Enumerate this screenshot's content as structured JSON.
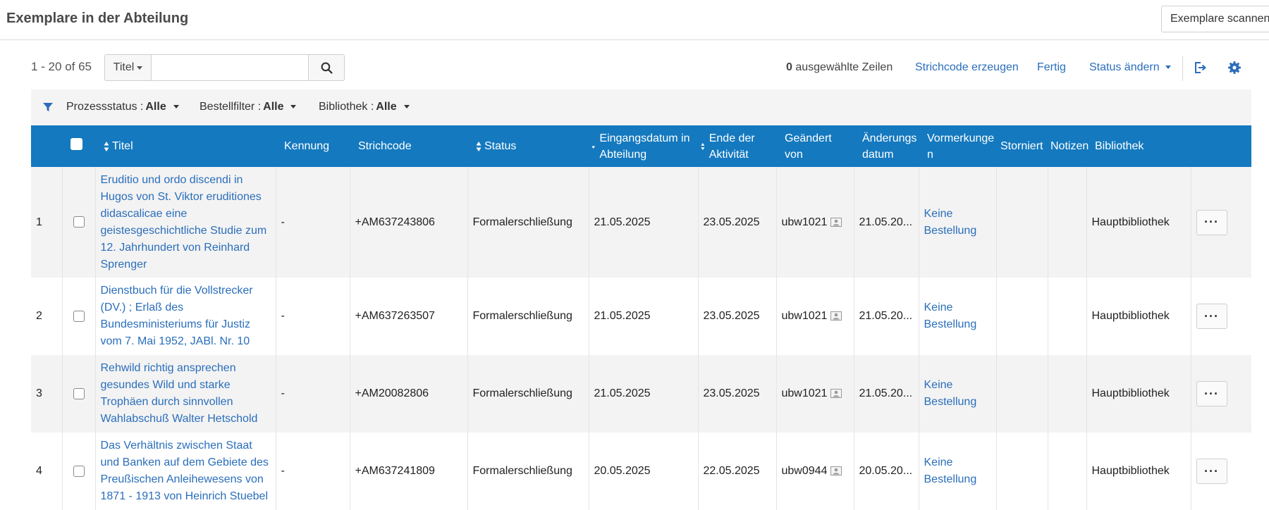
{
  "header": {
    "title": "Exemplare in der Abteilung",
    "scan_button": "Exemplare scannen"
  },
  "toolbar": {
    "count": "1 - 20 of 65",
    "search_field": "Titel",
    "search_value": "",
    "selected_count": "0",
    "selected_label": "ausgewählte Zeilen",
    "barcode_link": "Strichcode erzeugen",
    "done_link": "Fertig",
    "status_link": "Status ändern",
    "icons": [
      "export-icon",
      "gear-icon"
    ]
  },
  "filters": [
    {
      "label": "Prozessstatus :",
      "value": "Alle"
    },
    {
      "label": "Bestellfilter :",
      "value": "Alle"
    },
    {
      "label": "Bibliothek :",
      "value": "Alle"
    }
  ],
  "columns": {
    "title": "Titel",
    "id": "Kennung",
    "barcode": "Strichcode",
    "status": "Status",
    "received": "Eingangsdatum in Abteilung",
    "activity_end": "Ende der Aktivität",
    "modified_by": "Geändert von",
    "modified_date": "Änderungs datum",
    "requests": "Vormerkunge n",
    "cancelled": "Storniert",
    "notes": "Notizen",
    "library": "Bibliothek"
  },
  "rows": [
    {
      "num": "1",
      "title": "Eruditio und ordo discendi in Hugos von St. Viktor eruditiones didascalicae eine geistesgeschichtliche Studie zum 12. Jahrhundert von Reinhard Sprenger",
      "id": "-",
      "barcode": "+AM637243806",
      "status": "Formalerschließung",
      "received": "21.05.2025",
      "activity_end": "23.05.2025",
      "modified_by": "ubw1021",
      "modified_date": "21.05.20...",
      "requests": "Keine Bestellung",
      "cancelled": "",
      "notes": "",
      "library": "Hauptbibliothek",
      "more": "···"
    },
    {
      "num": "2",
      "title": "Dienstbuch für die Vollstrecker (DV.) ; Erlaß des Bundesministeriums für Justiz vom 7. Mai 1952, JABl. Nr. 10",
      "id": "-",
      "barcode": "+AM637263507",
      "status": "Formalerschließung",
      "received": "21.05.2025",
      "activity_end": "23.05.2025",
      "modified_by": "ubw1021",
      "modified_date": "21.05.20...",
      "requests": "Keine Bestellung",
      "cancelled": "",
      "notes": "",
      "library": "Hauptbibliothek",
      "more": "···"
    },
    {
      "num": "3",
      "title": "Rehwild richtig ansprechen gesundes Wild und starke Trophäen durch sinnvollen Wahlabschuß Walter Hetschold",
      "id": "-",
      "barcode": "+AM20082806",
      "status": "Formalerschließung",
      "received": "21.05.2025",
      "activity_end": "23.05.2025",
      "modified_by": "ubw1021",
      "modified_date": "21.05.20...",
      "requests": "Keine Bestellung",
      "cancelled": "",
      "notes": "",
      "library": "Hauptbibliothek",
      "more": "···"
    },
    {
      "num": "4",
      "title": "Das Verhältnis zwischen Staat und Banken auf dem Gebiete des Preußischen Anleihewesens von 1871 - 1913 von Heinrich Stuebel",
      "id": "-",
      "barcode": "+AM637241809",
      "status": "Formalerschließung",
      "received": "20.05.2025",
      "activity_end": "22.05.2025",
      "modified_by": "ubw0944",
      "modified_date": "20.05.20...",
      "requests": "Keine Bestellung",
      "cancelled": "",
      "notes": "",
      "library": "Hauptbibliothek",
      "more": "···"
    }
  ]
}
